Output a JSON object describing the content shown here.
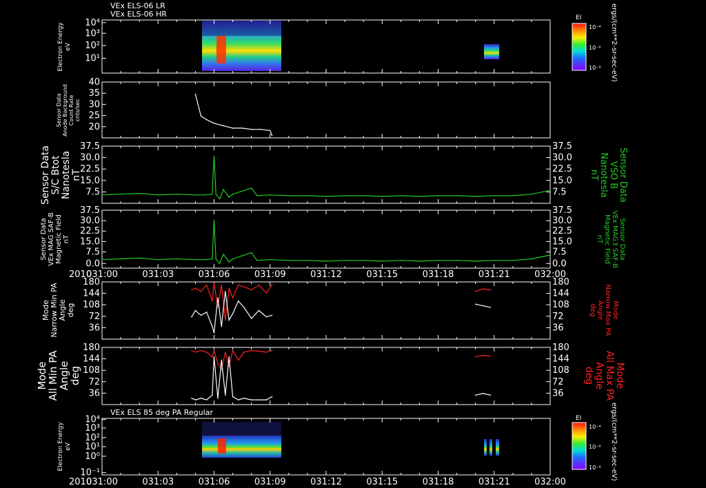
{
  "titles": {
    "top_line1": "VEx ELS-06 LR",
    "top_line2": "VEx ELS-06 HR",
    "bottom_title": "VEx ELS 85 deg PA Regular"
  },
  "colorbar": {
    "label": "EI",
    "units": "ergs/(cm**2-sr-sec-eV)",
    "ticks": [
      "10⁻⁴",
      "10⁻⁶",
      "10⁻⁸"
    ]
  },
  "colors": {
    "background": "#000000",
    "axes": "#ffffff",
    "green": "#22cc22",
    "red": "#ff2222",
    "white_trace": "#ffffff"
  },
  "x_axis": {
    "year": "2010",
    "ticks": [
      "031:00",
      "031:03",
      "031:06",
      "031:09",
      "031:12",
      "031:15",
      "031:18",
      "031:21",
      "032:00"
    ]
  },
  "panels": {
    "p1": {
      "ylabel": [
        "Electron Energy",
        "eV"
      ],
      "yticks": [
        "10⁴",
        "10³",
        "10²",
        "10¹"
      ]
    },
    "p2": {
      "ylabel": [
        "Sensor Data",
        "Anode Background",
        "Count Rate",
        "cnts/sec"
      ],
      "yticks": [
        "40",
        "35",
        "30",
        "25",
        "20"
      ]
    },
    "p3": {
      "ylabel": [
        "Sensor Data",
        "S/C Btot",
        "Nanotesla",
        "nT"
      ],
      "right_label": [
        "Sensor Data",
        "VSO B",
        "Nanotesla",
        "nT"
      ],
      "yticks": [
        "37.5",
        "30.0",
        "22.5",
        "15.0",
        "7.5"
      ]
    },
    "p4": {
      "ylabel": [
        "Sensor Data",
        "VEx MAG SAF-B",
        "Magnetic Field",
        "nT"
      ],
      "right_label": [
        "Sensor Data",
        "VEx MAG3 SAF-B",
        "Magnetic Field",
        "nT"
      ],
      "yticks": [
        "37.5",
        "30.0",
        "22.5",
        "15.0",
        "7.5",
        "0.0"
      ]
    },
    "p5": {
      "ylabel": [
        "Mode",
        "Narrow Min PA",
        "Angle",
        "deg"
      ],
      "right_label": [
        "Mode",
        "Narrow Max PA",
        "Angle",
        "deg"
      ],
      "yticks": [
        "180",
        "144",
        "108",
        "72",
        "36"
      ]
    },
    "p6": {
      "ylabel": [
        "Mode",
        "All Min PA",
        "Angle",
        "deg"
      ],
      "right_label": [
        "Mode",
        "All Max PA",
        "Angle",
        "deg"
      ],
      "yticks": [
        "180",
        "144",
        "108",
        "72",
        "36"
      ]
    },
    "p7": {
      "ylabel": [
        "Electron Energy",
        "eV"
      ],
      "yticks": [
        "10⁴",
        "10³",
        "10²",
        "10¹",
        "10⁰",
        "10⁻¹"
      ]
    }
  },
  "chart_data": [
    {
      "type": "heatmap",
      "title": "VEx ELS-06 LR / VEx ELS-06 HR",
      "ylabel": "Electron Energy eV",
      "yscale": "log",
      "time_coverage": [
        [
          "031:05.0",
          "031:09.1"
        ],
        [
          "031:20.0",
          "031:20.8"
        ]
      ],
      "colorbar_label": "EI"
    },
    {
      "type": "line",
      "ylabel": "Sensor Data Anode Background Count Rate cnts/sec",
      "ylim": [
        17,
        40
      ],
      "x": [
        5.0,
        5.3,
        5.6,
        6.0,
        6.5,
        7.0,
        7.5,
        8.0,
        8.5,
        9.0,
        9.1
      ],
      "values": [
        35,
        26,
        24.5,
        23,
        22,
        21,
        21,
        20.5,
        20.5,
        20,
        18
      ]
    },
    {
      "type": "line",
      "ylabel": "Sensor Data S/C Btot Nanotesla nT",
      "ylim": [
        0,
        37.5
      ],
      "x": [
        0,
        1,
        2,
        3,
        4,
        5,
        5.5,
        5.9,
        6.0,
        6.1,
        6.3,
        6.5,
        6.8,
        7.0,
        7.5,
        8.0,
        8.3,
        9,
        10,
        11,
        12,
        13,
        14,
        15,
        16,
        17,
        18,
        19,
        20,
        21,
        22,
        23,
        24
      ],
      "values": [
        5.5,
        6,
        6.5,
        5.5,
        6,
        5.5,
        5.5,
        6,
        31,
        6,
        3,
        9,
        4,
        6,
        8,
        10,
        5,
        5.5,
        5,
        5,
        4.5,
        5,
        5,
        4.5,
        5,
        4.5,
        5,
        5,
        4.5,
        5,
        5,
        6,
        8.5
      ]
    },
    {
      "type": "line",
      "ylabel": "Sensor Data VEx MAG SAF-B Magnetic Field nT",
      "ylim": [
        0,
        37.5
      ],
      "x": [
        0,
        1,
        2,
        3,
        4,
        5,
        5.5,
        5.9,
        6.0,
        6.1,
        6.3,
        6.5,
        6.8,
        7.0,
        7.5,
        8.0,
        8.3,
        9,
        10,
        11,
        12,
        13,
        14,
        15,
        16,
        17,
        18,
        19,
        20,
        21,
        22,
        23,
        24
      ],
      "values": [
        5.5,
        6,
        6.5,
        5.5,
        6,
        5.5,
        5.5,
        6,
        31,
        6,
        3,
        9,
        4,
        6,
        8,
        10,
        5,
        5.5,
        5,
        5,
        4.5,
        5,
        5,
        4.5,
        5,
        4.5,
        5,
        5,
        4.5,
        5,
        5,
        6,
        8.5
      ]
    },
    {
      "type": "line",
      "ylabel": "Mode Narrow Min PA / Max PA Angle deg",
      "ylim": [
        0,
        180
      ],
      "series": [
        {
          "name": "Narrow Min PA",
          "x": [
            4.8,
            5.0,
            5.3,
            5.6,
            5.9,
            6.0,
            6.2,
            6.4,
            6.6,
            6.8,
            7.0,
            7.3,
            7.6,
            8.0,
            8.4,
            8.8,
            9.1,
            20.0,
            20.4,
            20.8
          ],
          "values": [
            70,
            90,
            75,
            85,
            40,
            20,
            130,
            40,
            150,
            60,
            80,
            120,
            100,
            65,
            90,
            70,
            75,
            110,
            105,
            100
          ]
        },
        {
          "name": "Narrow Max PA",
          "x": [
            4.8,
            5.0,
            5.3,
            5.6,
            5.9,
            6.0,
            6.2,
            6.4,
            6.6,
            6.8,
            7.0,
            7.3,
            7.6,
            8.0,
            8.4,
            8.8,
            9.1,
            20.0,
            20.4,
            20.8
          ],
          "values": [
            155,
            160,
            150,
            170,
            120,
            175,
            100,
            170,
            60,
            160,
            130,
            170,
            165,
            155,
            170,
            145,
            170,
            150,
            158,
            155
          ]
        }
      ]
    },
    {
      "type": "line",
      "ylabel": "Mode All Min PA / Max PA Angle deg",
      "ylim": [
        0,
        180
      ],
      "series": [
        {
          "name": "All Min PA",
          "x": [
            4.8,
            5.0,
            5.3,
            5.6,
            5.9,
            6.0,
            6.2,
            6.4,
            6.6,
            6.8,
            7.0,
            7.3,
            7.6,
            8.0,
            8.4,
            8.8,
            9.1,
            20.0,
            20.4,
            20.8
          ],
          "values": [
            20,
            15,
            20,
            15,
            30,
            150,
            20,
            140,
            30,
            150,
            25,
            15,
            20,
            15,
            15,
            15,
            25,
            30,
            35,
            30
          ]
        },
        {
          "name": "All Max PA",
          "x": [
            4.8,
            5.0,
            5.3,
            5.6,
            5.9,
            6.0,
            6.2,
            6.4,
            6.6,
            6.8,
            7.0,
            7.3,
            7.6,
            8.0,
            8.4,
            8.8,
            9.1,
            20.0,
            20.4,
            20.8
          ],
          "values": [
            170,
            165,
            170,
            165,
            150,
            170,
            130,
            110,
            165,
            120,
            170,
            140,
            165,
            170,
            168,
            165,
            170,
            150,
            155,
            152
          ]
        }
      ]
    },
    {
      "type": "heatmap",
      "title": "VEx ELS 85 deg PA Regular",
      "ylabel": "Electron Energy eV",
      "yscale": "log",
      "time_coverage": [
        [
          "031:05.0",
          "031:09.1"
        ],
        [
          "031:20.0",
          "031:20.8"
        ]
      ],
      "colorbar_label": "EI"
    }
  ]
}
